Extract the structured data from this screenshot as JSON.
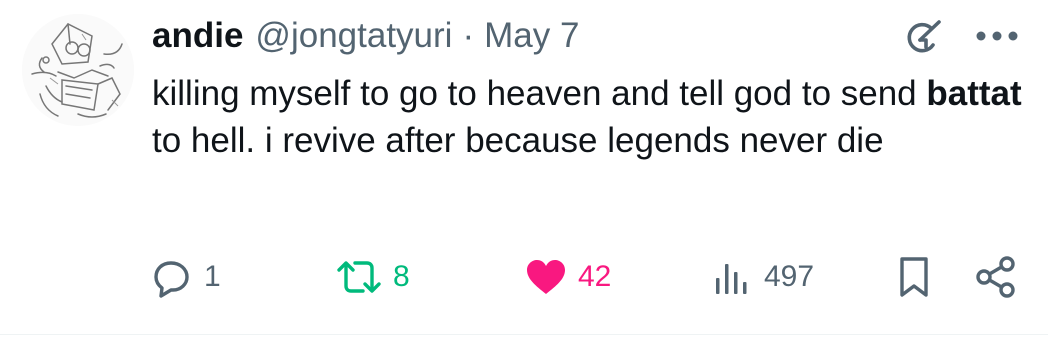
{
  "tweet": {
    "author": {
      "display_name": "andie",
      "handle": "@jongtatyuri"
    },
    "separator": "·",
    "date": "May 7",
    "text": {
      "part1": "killing myself to go to heaven and tell god to send ",
      "bold": "battat",
      "part2": " to hell. i revive after because legends never die"
    },
    "actions": {
      "replies": "1",
      "retweets": "8",
      "likes": "42",
      "views": "497"
    },
    "icons": {
      "grok": "grok-icon",
      "more": "more-icon",
      "reply": "reply-icon",
      "retweet": "retweet-icon",
      "like": "heart-icon",
      "views": "views-icon",
      "bookmark": "bookmark-icon",
      "share": "share-icon"
    },
    "colors": {
      "text": "#0f1419",
      "secondary": "#536471",
      "retweet": "#00ba7c",
      "like": "#f91880",
      "divider": "#eff3f4"
    }
  }
}
